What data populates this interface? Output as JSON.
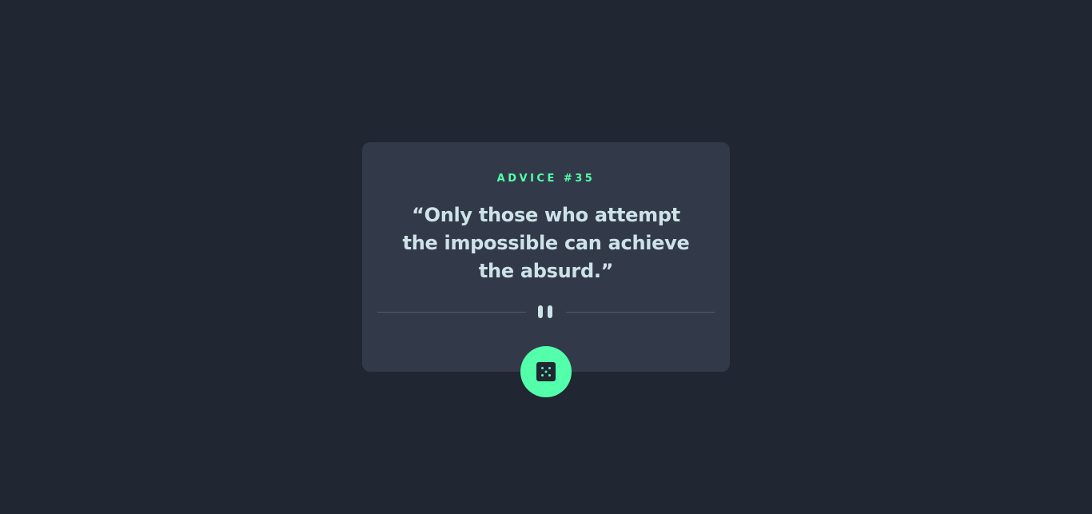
{
  "card": {
    "label": "ADVICE #35",
    "quote": "“Only those who attempt the impossible can achieve the absurd.”"
  },
  "divider": {
    "icon": "pause-icon"
  },
  "button": {
    "icon": "dice-icon",
    "accent_color": "#53FFAA"
  },
  "colors": {
    "background": "#202632",
    "card": "#323A49",
    "text": "#CEE3E9",
    "accent": "#53FFAA",
    "divider": "#4F5D74"
  }
}
